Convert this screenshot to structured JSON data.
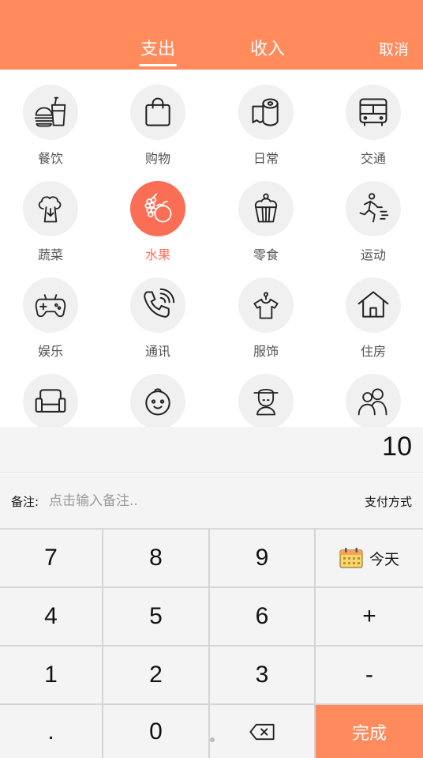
{
  "header": {
    "tabs": [
      {
        "label": "支出",
        "active": true
      },
      {
        "label": "收入",
        "active": false
      }
    ],
    "cancel_label": "取消",
    "background_color": "#FF8A5C"
  },
  "categories": [
    {
      "label": "餐饮",
      "icon": "fast-food-icon"
    },
    {
      "label": "购物",
      "icon": "shopping-bag-icon"
    },
    {
      "label": "日常",
      "icon": "toilet-paper-icon"
    },
    {
      "label": "交通",
      "icon": "bus-icon"
    },
    {
      "label": "蔬菜",
      "icon": "broccoli-icon"
    },
    {
      "label": "水果",
      "icon": "fruit-icon",
      "selected": true
    },
    {
      "label": "零食",
      "icon": "cupcake-icon"
    },
    {
      "label": "运动",
      "icon": "running-person-icon"
    },
    {
      "label": "娱乐",
      "icon": "gamepad-icon"
    },
    {
      "label": "通讯",
      "icon": "phone-icon"
    },
    {
      "label": "服饰",
      "icon": "shirt-on-hanger-icon"
    },
    {
      "label": "住房",
      "icon": "house-icon"
    },
    {
      "label": "",
      "icon": "sofa-icon"
    },
    {
      "label": "",
      "icon": "baby-face-icon"
    },
    {
      "label": "",
      "icon": "elder-icon"
    },
    {
      "label": "",
      "icon": "family-icon"
    }
  ],
  "selected_color": "#FA6E55",
  "amount": "10",
  "note": {
    "label": "备注:",
    "placeholder": "点击输入备注..",
    "value": ""
  },
  "payment_method_label": "支付方式",
  "keypad": {
    "keys": [
      "7",
      "8",
      "9",
      "4",
      "5",
      "6",
      "+",
      "1",
      "2",
      "3",
      "-",
      ".",
      "0"
    ],
    "today_label": "今天",
    "done_label": "完成",
    "backspace_icon": "backspace-icon",
    "calendar_icon": "calendar-icon"
  }
}
